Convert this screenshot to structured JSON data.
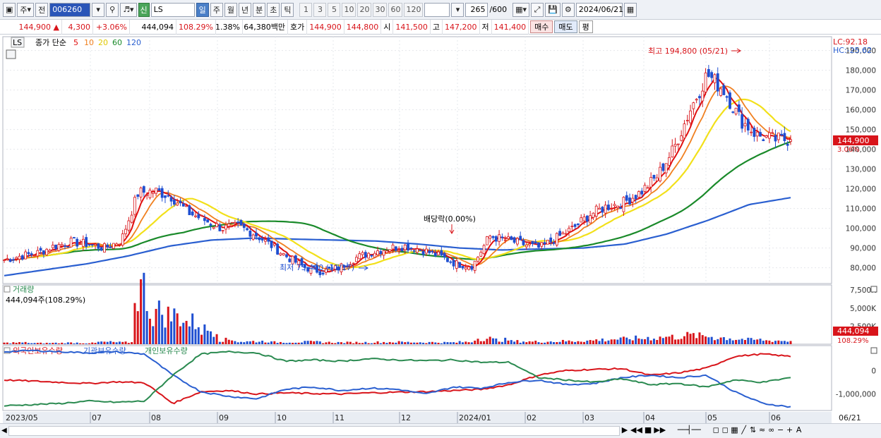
{
  "toolbar": {
    "market_label": "주",
    "prev_label": "전",
    "code": "006260",
    "name": "LS",
    "new_badge": "신",
    "period_tabs": [
      "일",
      "주",
      "월",
      "년",
      "분",
      "초",
      "틱"
    ],
    "active_tab": "일",
    "intervals": [
      "1",
      "3",
      "5",
      "10",
      "20",
      "30",
      "60",
      "120"
    ],
    "count": "265",
    "count_max": "/600",
    "date": "2024/06/21"
  },
  "quote": {
    "price": "144,900",
    "change_arrow": "▲",
    "change": "4,300",
    "change_pct": "+3.06%",
    "volume": "444,094",
    "vol_ratio": "108.29%",
    "turnover": "1.38%",
    "amount": "64,380백만",
    "ask_label": "호가",
    "ask": "144,900",
    "bid": "144,800",
    "open_label": "시",
    "open": "141,500",
    "high_label": "고",
    "high": "147,200",
    "low_label": "저",
    "low": "141,400",
    "buy_label": "매수",
    "sell_label": "매도",
    "eval_label": "평"
  },
  "legend": {
    "code": "LS",
    "series_prefix": "종가 단순",
    "ma_labels": [
      "5",
      "10",
      "20",
      "60",
      "120"
    ]
  },
  "lchc": {
    "lc": "LC:92.18",
    "hc": "HC:-25.62"
  },
  "annotations": {
    "high": "최고 194,800 (05/21)",
    "low": "최저 75,400 (11/17)",
    "dividend": "배당락(0.00%)",
    "last_price": "144,900",
    "last_pct": "3.06%"
  },
  "volume_panel": {
    "title": "거래량",
    "current": "444,094주(108.29%)",
    "last_label": "444,094",
    "last_pct": "108.29%"
  },
  "holdings_panel": {
    "legend": [
      "외국인보유수량",
      "기관보유수량",
      "개인보유수량"
    ]
  },
  "colors": {
    "up": "#d8141a",
    "down": "#1f4fd1",
    "ma5": "#e01010",
    "ma10": "#f08020",
    "ma20": "#f2e01a",
    "ma60": "#1a8a2a",
    "ma120": "#2a5fd0",
    "foreign": "#d8141a",
    "inst": "#2a5fd0",
    "retail": "#2a8a50"
  },
  "chart_data": [
    {
      "type": "candlestick",
      "title": "",
      "x_labels": [
        "2023/05",
        "07",
        "08",
        "09",
        "10",
        "11",
        "12",
        "2024/01",
        "02",
        "03",
        "04",
        "05",
        "06",
        "06/21"
      ],
      "y_ticks": [
        80000,
        90000,
        100000,
        110000,
        120000,
        130000,
        140000,
        150000,
        160000,
        170000,
        180000,
        190000
      ],
      "y_tick_labels": [
        "80,000",
        "90,000",
        "100,000",
        "110,000",
        "120,000",
        "130,000",
        "140,000",
        "150,000",
        "160,000",
        "170,000",
        "180,000",
        "190,000"
      ],
      "ylim": [
        72000,
        197000
      ],
      "close_trace": [
        84000,
        86000,
        87500,
        91000,
        93000,
        92000,
        90000,
        94000,
        118000,
        119000,
        116000,
        108000,
        104000,
        100000,
        101000,
        97000,
        91000,
        85000,
        80000,
        78000,
        80000,
        85000,
        88000,
        90000,
        91000,
        89000,
        86000,
        82000,
        81000,
        96000,
        94000,
        92000,
        90000,
        95000,
        100000,
        107000,
        111000,
        113000,
        118000,
        126000,
        140000,
        160000,
        178000,
        170000,
        155000,
        147000,
        145000,
        144900
      ],
      "ma120": [
        76000,
        79000,
        82000,
        86000,
        91000,
        94000,
        95000,
        94500,
        94000,
        93500,
        92000,
        90000,
        89000,
        89500,
        90000,
        92000,
        97000,
        104000,
        112000,
        115500
      ]
    },
    {
      "type": "bar",
      "title": "거래량",
      "y_tick_labels": [
        "7,500K",
        "5,000K",
        "2,500K"
      ],
      "ylim": [
        0,
        8000000
      ],
      "values": [
        180000,
        220000,
        150000,
        170000,
        200000,
        160000,
        300000,
        250000,
        7500000,
        4400000,
        3900000,
        3000000,
        2000000,
        600000,
        350000,
        400000,
        280000,
        300000,
        320000,
        260000,
        240000,
        250000,
        280000,
        300000,
        270000,
        260000,
        240000,
        300000,
        800000,
        600000,
        400000,
        350000,
        380000,
        420000,
        500000,
        600000,
        700000,
        800000,
        900000,
        1000000,
        1200000,
        1100000,
        900000,
        700000,
        600000,
        500000,
        444094
      ]
    },
    {
      "type": "line",
      "title": "외국인보유수량 / 기관보유수량 / 개인보유수량",
      "y_tick_labels": [
        "0",
        "-1,000,000"
      ],
      "series": [
        {
          "name": "외국인보유수량",
          "values": [
            -400000,
            -450000,
            -500000,
            -550000,
            -480000,
            -520000,
            -1400000,
            -900000,
            -850000,
            -1000000,
            -950000,
            -980000,
            -1000000,
            -950000,
            -920000,
            -900000,
            -850000,
            -800000,
            -600000,
            -200000,
            0,
            50000,
            80000,
            -200000,
            -100000,
            100000,
            600000,
            700000,
            600000
          ]
        },
        {
          "name": "기관보유수량",
          "values": [
            800000,
            850000,
            800000,
            750000,
            800000,
            700000,
            -200000,
            -900000,
            -1100000,
            -1200000,
            -800000,
            -700000,
            -850000,
            -750000,
            -800000,
            -1000000,
            -700000,
            -750000,
            -500000,
            -400000,
            -600000,
            -550000,
            -300000,
            -200000,
            -300000,
            -200000,
            -900000,
            -1400000,
            -1550000
          ]
        },
        {
          "name": "개인보유수량",
          "values": [
            -1500000,
            -1450000,
            -1400000,
            -1300000,
            -1350000,
            -1300000,
            -200000,
            700000,
            800000,
            750000,
            400000,
            450000,
            400000,
            500000,
            450000,
            420000,
            450000,
            350000,
            350000,
            -300000,
            -400000,
            -500000,
            -350000,
            -600000,
            -550000,
            -700000,
            -400000,
            -500000,
            -300000
          ]
        }
      ]
    }
  ]
}
